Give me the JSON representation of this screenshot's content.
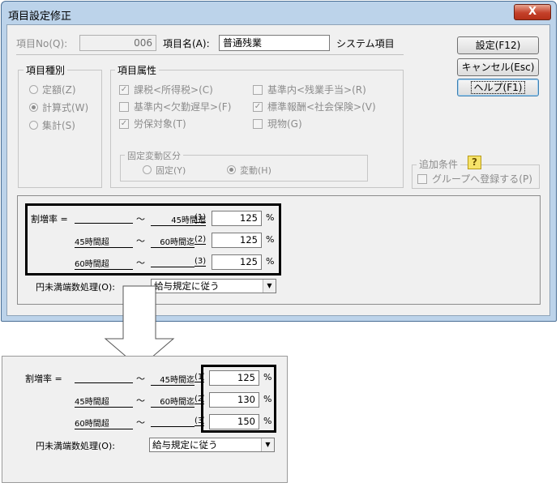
{
  "dialog": {
    "title": "項目設定修正",
    "close_label": "X"
  },
  "header": {
    "item_no_label": "項目No(Q):",
    "item_no_value": "006",
    "item_name_label": "項目名(A):",
    "item_name_value": "普通残業",
    "system_item_label": "システム項目"
  },
  "buttons": {
    "settings": "設定(F12)",
    "cancel": "キャンセル(Esc)",
    "help": "ヘルプ(F1)"
  },
  "item_type": {
    "title": "項目種別",
    "options": [
      "定額(Z)",
      "計算式(W)",
      "集計(S)"
    ],
    "selected": "計算式(W)"
  },
  "item_attr": {
    "title": "項目属性",
    "checks": [
      {
        "label": "課税<所得税>(C)",
        "checked": true
      },
      {
        "label": "基準内<欠勤遅早>(F)",
        "checked": false
      },
      {
        "label": "労保対象(T)",
        "checked": true
      },
      {
        "label": "基準内<残業手当>(R)",
        "checked": false
      },
      {
        "label": "標準報酬<社会保険>(V)",
        "checked": true
      },
      {
        "label": "現物(G)",
        "checked": false
      }
    ],
    "fixed_var": {
      "title": "固定変動区分",
      "options": [
        "固定(Y)",
        "変動(H)"
      ],
      "selected": "変動(H)"
    }
  },
  "extra": {
    "title": "追加条件",
    "checkbox_label": "グループへ登録する(P)"
  },
  "rates": {
    "label": "割増率 =",
    "rows": [
      {
        "from": "",
        "tilde": "～",
        "to": "45時間迄",
        "idx": "(1)",
        "value": "125",
        "unit": "%"
      },
      {
        "from": "45時間超",
        "tilde": "～",
        "to": "60時間迄",
        "idx": "(2)",
        "value": "125",
        "unit": "%"
      },
      {
        "from": "60時間超",
        "tilde": "～",
        "to": "",
        "idx": "(3)",
        "value": "125",
        "unit": "%"
      }
    ],
    "rounding_label": "円未満端数処理(O):",
    "rounding_value": "給与規定に従う"
  },
  "after": {
    "label": "割増率 =",
    "rows": [
      {
        "from": "",
        "tilde": "～",
        "to": "45時間迄",
        "idx": "(1)",
        "value": "125",
        "unit": "%"
      },
      {
        "from": "45時間超",
        "tilde": "～",
        "to": "60時間迄",
        "idx": "(2)",
        "value": "130",
        "unit": "%"
      },
      {
        "from": "60時間超",
        "tilde": "～",
        "to": "",
        "idx": "(3)",
        "value": "150",
        "unit": "%"
      }
    ],
    "rounding_label": "円未満端数処理(O):",
    "rounding_value": "給与規定に従う"
  }
}
